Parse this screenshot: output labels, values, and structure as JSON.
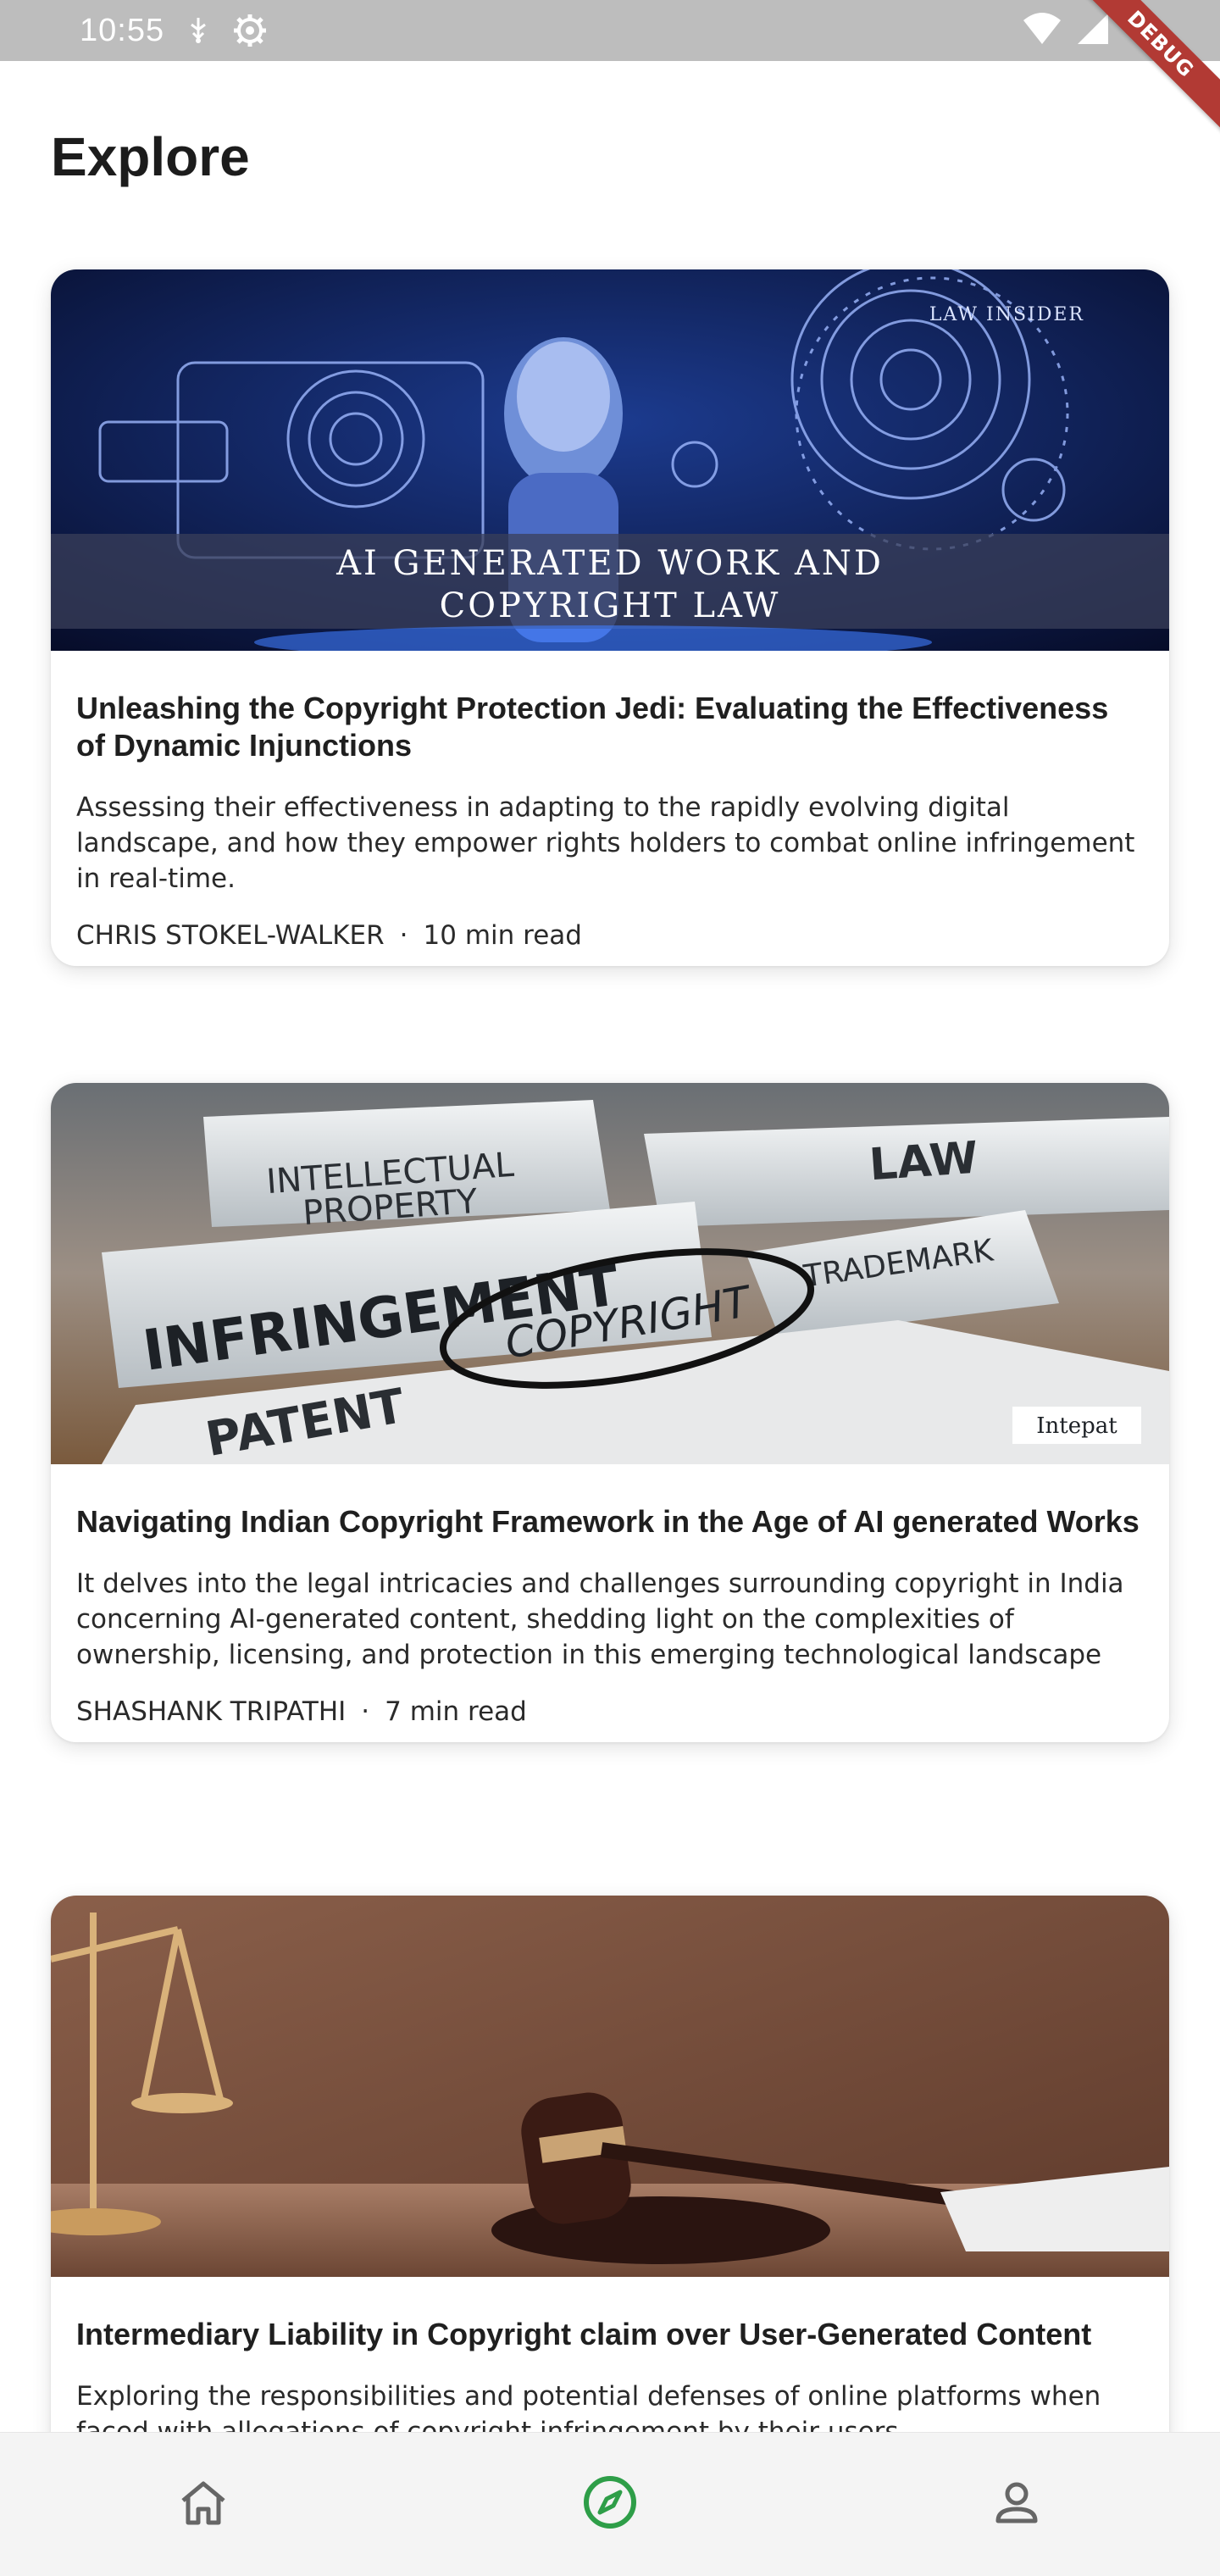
{
  "status_bar": {
    "time": "10:55",
    "icons": [
      "usb-debug-icon",
      "settings-gear-icon",
      "wifi-icon",
      "signal-icon"
    ],
    "debug_ribbon": "DEBUG"
  },
  "page": {
    "title": "Explore"
  },
  "articles": [
    {
      "image_caption_line1": "AI GENERATED WORK AND",
      "image_caption_line2": "COPYRIGHT LAW",
      "image_brand": "LAW INSIDER",
      "title": "Unleashing the Copyright Protection Jedi: Evaluating the Effectiveness of Dynamic Injunctions",
      "description": "Assessing their effectiveness in adapting to the rapidly evolving digital landscape, and how they empower rights holders to combat online infringement in real-time.",
      "author": "CHRIS STOKEL-WALKER",
      "separator": "·",
      "read_time": "10 min read"
    },
    {
      "image_labels": {
        "ip": "INTELLECTUAL PROPERTY",
        "ip_line1": "INTELLECTUAL",
        "ip_line2": "PROPERTY",
        "law": "LAW",
        "infringement": "INFRINGEMENT",
        "trademark": "TRADEMARK",
        "copyright": "COPYRIGHT",
        "patent": "PATENT",
        "brand": "Intepat"
      },
      "title": "Navigating Indian Copyright Framework in the Age of AI generated Works",
      "description": "It delves into the legal intricacies and challenges surrounding copyright in India concerning AI-generated content, shedding light on the complexities of ownership, licensing, and protection in this emerging technological landscape",
      "author": "SHASHANK TRIPATHI",
      "separator": "·",
      "read_time": "7 min read"
    },
    {
      "title": "Intermediary Liability in Copyright claim over User-Generated Content",
      "description": "Exploring the responsibilities and potential defenses of online platforms when faced with allegations of copyright infringement by their users."
    }
  ],
  "bottom_nav": {
    "items": [
      {
        "icon": "home-icon",
        "active": false
      },
      {
        "icon": "compass-icon",
        "active": true
      },
      {
        "icon": "person-icon",
        "active": false
      }
    ],
    "active_color": "#2e9e48",
    "inactive_color": "#666666"
  }
}
